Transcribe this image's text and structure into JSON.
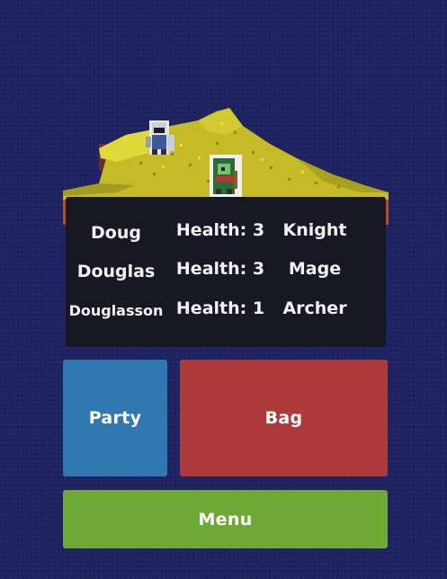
{
  "scene": {
    "characters": [
      "knight-sprite",
      "archer-sprite"
    ]
  },
  "party": {
    "members": [
      {
        "name": "Doug",
        "health": "Health: 3",
        "class": "Knight"
      },
      {
        "name": "Douglas",
        "health": "Health: 3",
        "class": "Mage"
      },
      {
        "name": "Douglasson",
        "health": "Health: 1",
        "class": "Archer"
      }
    ]
  },
  "buttons": {
    "party_label": "Party",
    "bag_label": "Bag",
    "menu_label": "Menu"
  },
  "colors": {
    "background": "#1f2260",
    "panel": "#171823",
    "party_button": "#3278b0",
    "bag_button": "#ac3a3a",
    "menu_button": "#6fa935",
    "grass": "#c9c12a"
  }
}
